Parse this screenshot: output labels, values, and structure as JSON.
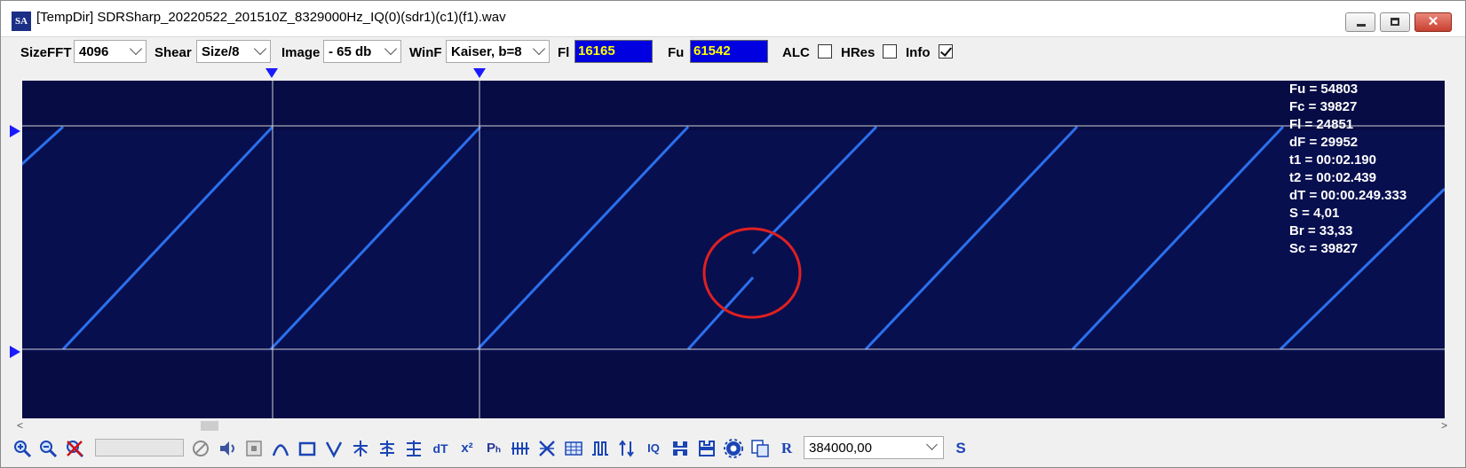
{
  "window": {
    "title": "[TempDir] SDRSharp_20220522_201510Z_8329000Hz_IQ(0)(sdr1)(c1)(f1).wav",
    "app_icon": "SA",
    "close_glyph": "✕"
  },
  "toolbar": {
    "sizefft": {
      "label": "SizeFFT",
      "value": "4096"
    },
    "shear": {
      "label": "Shear",
      "value": "Size/8"
    },
    "image": {
      "label": "Image",
      "value": "- 65 db"
    },
    "winf": {
      "label": "WinF",
      "value": "Kaiser, b=8"
    },
    "fl": {
      "label": "Fl",
      "value": "16165"
    },
    "fu": {
      "label": "Fu",
      "value": "61542"
    },
    "alc": {
      "label": "ALC",
      "checked": false
    },
    "hres": {
      "label": "HRes",
      "checked": false
    },
    "info": {
      "label": "Info",
      "checked": true
    }
  },
  "info_panel": [
    "Fu = 54803",
    "Fc = 39827",
    "Fl = 24851",
    "dF = 29952",
    "t1 = 00:02.190",
    "t2 = 00:02.439",
    "dT = 00:00.249.333",
    "S = 4,01",
    "Br = 33,33",
    "Sc = 39827"
  ],
  "scroll": {
    "left_arrow": "<",
    "right_arrow": ">"
  },
  "bottombar": {
    "sample_rate": "384000,00",
    "icons": [
      "zoom-in-icon",
      "zoom-out-icon",
      "zoom-reset-icon",
      "disabled-icon",
      "speaker-icon",
      "stop-icon",
      "fm-icon",
      "rect-icon",
      "v-icon",
      "tune-icon",
      "tune2-icon",
      "tune3-icon",
      "dt-icon",
      "x2-icon",
      "ph-icon",
      "bars-icon",
      "cross-icon",
      "grid-icon",
      "pulse-icon",
      "arrows-icon",
      "iq-icon",
      "pattern1-icon",
      "pattern2-icon",
      "gear-icon",
      "copy-icon",
      "r-icon",
      "s-icon"
    ],
    "icon_glyphs": {
      "dt": "dT",
      "x2": "x²",
      "ph": "Pₕ",
      "iq": "IQ",
      "r": "R",
      "s": "S"
    }
  },
  "colors": {
    "spectro_bg": "#060a3c",
    "trace": "#2f7bff",
    "marker": "#1a1aff",
    "annotation_circle": "#e02020",
    "fl_fu_bg": "#0000e0",
    "fl_fu_text": "#ffff00"
  }
}
